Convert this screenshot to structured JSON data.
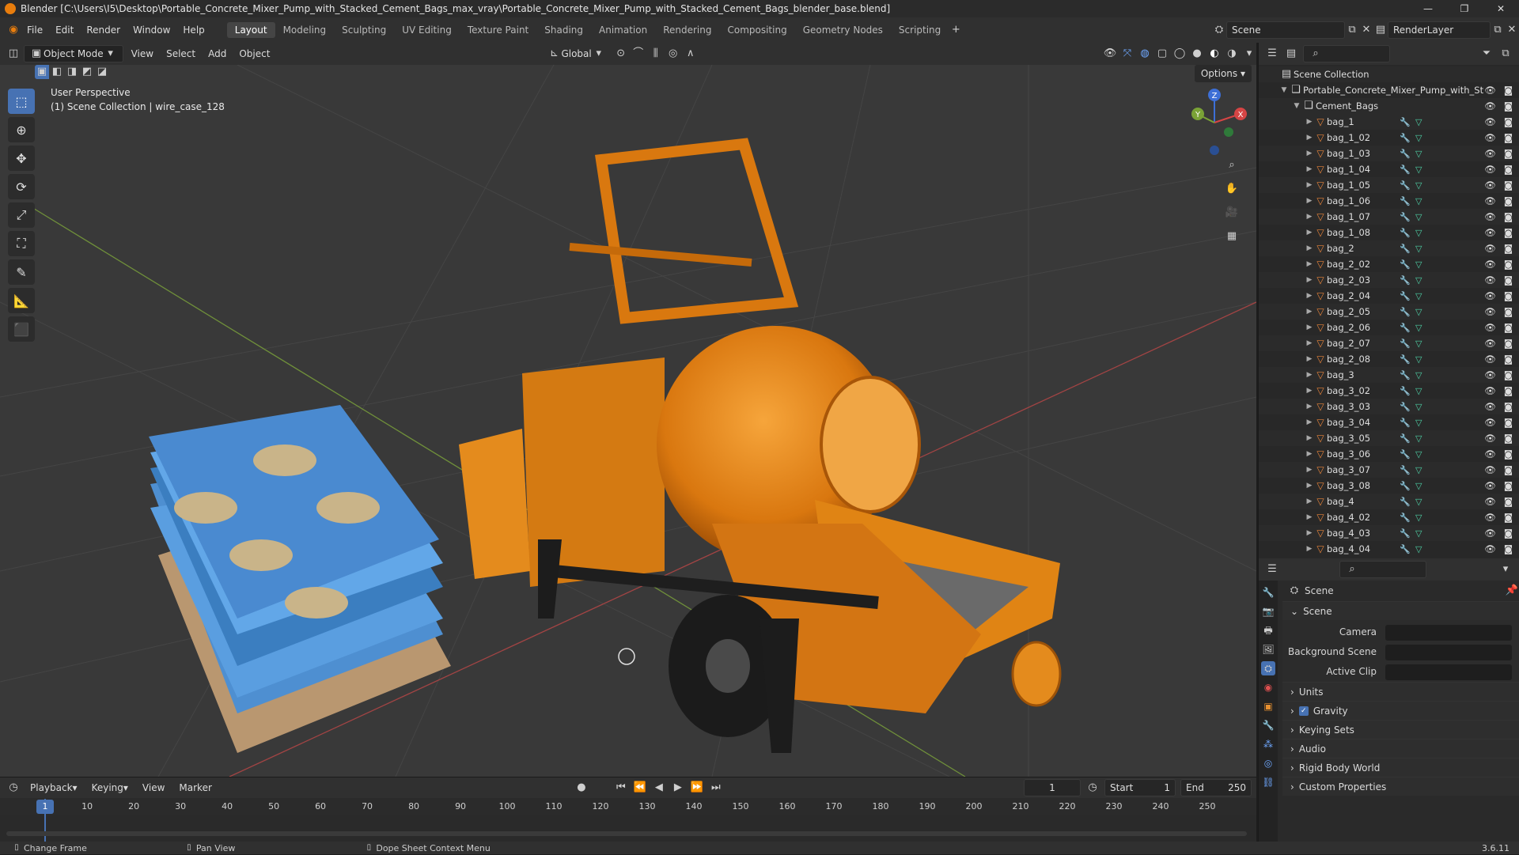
{
  "window": {
    "title": "Blender [C:\\Users\\I5\\Desktop\\Portable_Concrete_Mixer_Pump_with_Stacked_Cement_Bags_max_vray\\Portable_Concrete_Mixer_Pump_with_Stacked_Cement_Bags_blender_base.blend]",
    "minimize": "—",
    "maximize": "❐",
    "close": "✕"
  },
  "menu": [
    "File",
    "Edit",
    "Render",
    "Window",
    "Help"
  ],
  "workspaces": [
    "Layout",
    "Modeling",
    "Sculpting",
    "UV Editing",
    "Texture Paint",
    "Shading",
    "Animation",
    "Rendering",
    "Compositing",
    "Geometry Nodes",
    "Scripting"
  ],
  "active_workspace": "Layout",
  "scene_name": "Scene",
  "render_layer": "RenderLayer",
  "viewport_header": {
    "mode": "Object Mode",
    "view": "View",
    "select": "Select",
    "add": "Add",
    "object": "Object",
    "orientation": "Global",
    "options": "Options"
  },
  "viewport": {
    "perspective": "User Perspective",
    "collection_info": "(1) Scene Collection | wire_case_128"
  },
  "gizmo": {
    "x": "X",
    "y": "Y",
    "z": "Z"
  },
  "outliner": {
    "root": "Scene Collection",
    "file_collection": "Portable_Concrete_Mixer_Pump_with_St",
    "subcollection": "Cement_Bags",
    "items": [
      "bag_1",
      "bag_1_02",
      "bag_1_03",
      "bag_1_04",
      "bag_1_05",
      "bag_1_06",
      "bag_1_07",
      "bag_1_08",
      "bag_2",
      "bag_2_02",
      "bag_2_03",
      "bag_2_04",
      "bag_2_05",
      "bag_2_06",
      "bag_2_07",
      "bag_2_08",
      "bag_3",
      "bag_3_02",
      "bag_3_03",
      "bag_3_04",
      "bag_3_05",
      "bag_3_06",
      "bag_3_07",
      "bag_3_08",
      "bag_4",
      "bag_4_02",
      "bag_4_03",
      "bag_4_04"
    ]
  },
  "properties": {
    "context": "Scene",
    "panel": "Scene",
    "camera_label": "Camera",
    "background_scene_label": "Background Scene",
    "active_clip_label": "Active Clip",
    "sections": [
      "Units",
      "Gravity",
      "Keying Sets",
      "Audio",
      "Rigid Body World",
      "Custom Properties"
    ]
  },
  "timeline": {
    "playback": "Playback",
    "keying": "Keying",
    "view": "View",
    "marker": "Marker",
    "current_frame": "1",
    "start_label": "Start",
    "start": "1",
    "end_label": "End",
    "end": "250",
    "ticks": [
      "1",
      "10",
      "20",
      "30",
      "40",
      "50",
      "60",
      "70",
      "80",
      "90",
      "100",
      "110",
      "120",
      "130",
      "140",
      "150",
      "160",
      "170",
      "180",
      "190",
      "200",
      "210",
      "220",
      "230",
      "240",
      "250"
    ]
  },
  "statusbar": {
    "left": "Change Frame",
    "middle": "Pan View",
    "right": "Dope Sheet Context Menu",
    "version": "3.6.11"
  },
  "colors": {
    "accent": "#4772b3",
    "orange": "#e87d0d",
    "mixer": "#e0891c"
  }
}
